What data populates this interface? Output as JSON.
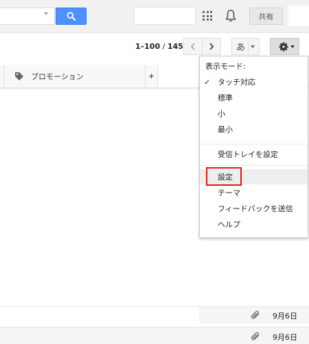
{
  "header": {
    "search_button_icon": "search-icon",
    "apps_icon": "apps-grid-icon",
    "notifications_icon": "bell-icon",
    "share_label": "共有"
  },
  "toolbar": {
    "pager": {
      "range": "1–100",
      "separator": " / ",
      "total": "145"
    },
    "prev_icon": "chevron-left-icon",
    "next_icon": "chevron-right-icon",
    "ime_label": "あ",
    "settings_icon": "gear-icon"
  },
  "tabs": {
    "promotions_label": "プロモーション",
    "promotions_icon": "tag-icon",
    "add_label": "+"
  },
  "settings_menu": {
    "display_mode_header": "表示モード:",
    "options": [
      {
        "label": "タッチ対応",
        "checked": true
      },
      {
        "label": "標準"
      },
      {
        "label": "小"
      },
      {
        "label": "最小"
      }
    ],
    "configure_inbox": "受信トレイを設定",
    "settings": "設定",
    "themes": "テーマ",
    "send_feedback": "フィードバックを送信",
    "help": "ヘルプ",
    "highlight_color": "#e0141c"
  },
  "mail_rows": [
    {
      "attachment_icon": "paperclip-icon",
      "date": "9月6日"
    },
    {
      "attachment_icon": "paperclip-icon",
      "date": "9月6日"
    }
  ],
  "colors": {
    "search_button": "#4d90fe",
    "highlight_box": "#e0141c"
  }
}
